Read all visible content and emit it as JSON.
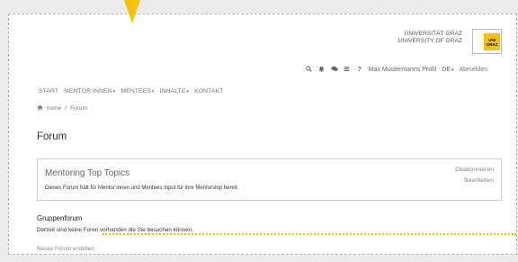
{
  "university": {
    "line1": "UNIVERSITÄT GRAZ",
    "line2": "UNIVERSITY OF GRAZ",
    "logo_text": "UNI GRAZ"
  },
  "utility": {
    "icons": [
      "search-icon",
      "bell-icon",
      "chat-icon",
      "menu-icon",
      "help-icon"
    ],
    "user_profile": "Max Mustermanns Profil",
    "language": "DE",
    "logout": "Abmelden"
  },
  "nav": {
    "start": "START",
    "mentorinnen": "MENTOR:INNEN",
    "mentees": "MENTEES",
    "inhalte": "INHALTE",
    "kontakt": "KONTAKT",
    "caret": "▾"
  },
  "breadcrumb": {
    "home": "home",
    "sep": "/",
    "current": "Forum"
  },
  "page": {
    "title": "Forum"
  },
  "card": {
    "title": "Mentoring Top Topics",
    "description": "Dieses Forum hält für Mentor:innen und Mentees Input für ihre Mentorship bereit.",
    "unsubscribe": "Deabonnieren",
    "edit": "Bearbeiten"
  },
  "group": {
    "heading": "Gruppenforum",
    "empty_text": "Derzeit sind keine Foren vorhanden die Sie besuchen können.",
    "new_forum": "Neues Forum erstellen"
  },
  "colors": {
    "accent": "#f5c400",
    "text": "#333333",
    "muted": "#888888"
  }
}
